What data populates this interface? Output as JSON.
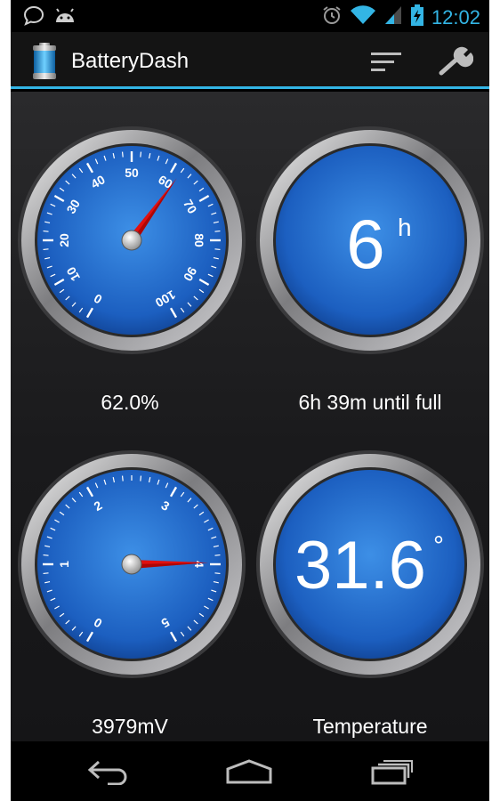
{
  "status_bar": {
    "time": "12:02",
    "left_icons": [
      "chat-bubble-icon",
      "android-icon"
    ],
    "right_icons": [
      "alarm-icon",
      "wifi-icon",
      "signal-icon",
      "battery-charging-icon"
    ]
  },
  "action_bar": {
    "title": "BatteryDash",
    "app_icon": "battery-icon",
    "actions": [
      "sort-icon",
      "wrench-icon"
    ],
    "accent_color": "#33b5e5"
  },
  "gauges": {
    "level": {
      "type": "dial",
      "tick_labels": [
        "0",
        "10",
        "20",
        "30",
        "40",
        "50",
        "60",
        "70",
        "80",
        "90",
        "100"
      ],
      "value": 62.0,
      "label": "62.0%"
    },
    "time": {
      "type": "digital",
      "value": "6",
      "unit": "h",
      "label": "6h 39m until full"
    },
    "voltage": {
      "type": "dial",
      "tick_labels": [
        "0",
        "1",
        "2",
        "3",
        "4",
        "5"
      ],
      "value": 3.979,
      "label": "3979mV"
    },
    "temperature": {
      "type": "digital",
      "value": "31.6",
      "unit": "°",
      "label": "Temperature"
    }
  },
  "nav_bar": {
    "buttons": [
      "back-icon",
      "home-icon",
      "recent-apps-icon"
    ]
  }
}
